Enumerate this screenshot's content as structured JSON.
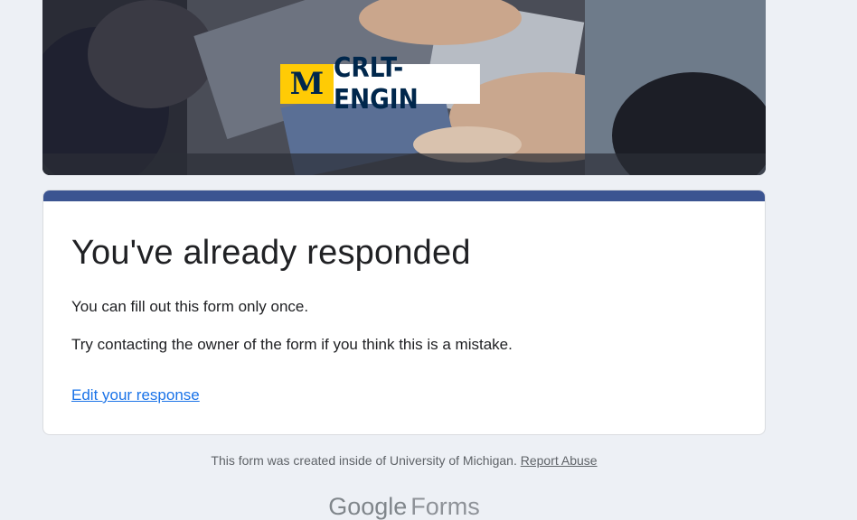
{
  "banner": {
    "logo_mark": "M",
    "logo_text": "CRLT-ENGIN",
    "colors": {
      "maize": "#ffcb05",
      "blue": "#00274c"
    }
  },
  "card": {
    "accent_color": "#3b5491",
    "title": "You've already responded",
    "line1": "You can fill out this form only once.",
    "line2": "Try contacting the owner of the form if you think this is a mistake.",
    "edit_link": "Edit your response"
  },
  "footer": {
    "text": "This form was created inside of University of Michigan.",
    "report_abuse": "Report Abuse"
  },
  "brand": {
    "google": "Google",
    "forms": "Forms"
  }
}
